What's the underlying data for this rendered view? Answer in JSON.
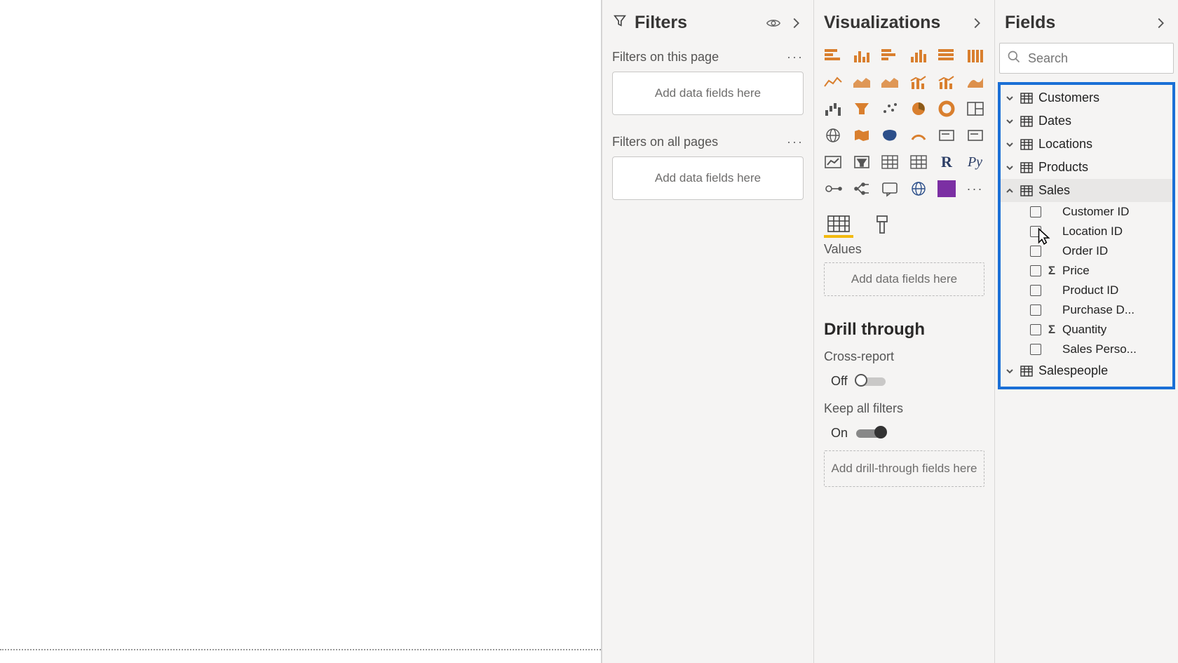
{
  "filters": {
    "title": "Filters",
    "page_label": "Filters on this page",
    "all_label": "Filters on all pages",
    "drop_placeholder": "Add data fields here"
  },
  "viz": {
    "title": "Visualizations",
    "values_label": "Values",
    "values_placeholder": "Add data fields here",
    "drill_heading": "Drill through",
    "cross_report_label": "Cross-report",
    "cross_report_state": "Off",
    "keep_filters_label": "Keep all filters",
    "keep_filters_state": "On",
    "drill_placeholder": "Add drill-through fields here",
    "chips": [
      "stacked-bar",
      "stacked-column",
      "clustered-bar",
      "clustered-column",
      "100-bar",
      "100-column",
      "line",
      "area",
      "stacked-area",
      "line-column",
      "line-column-2",
      "ribbon",
      "waterfall",
      "funnel",
      "scatter",
      "pie",
      "donut",
      "treemap",
      "map",
      "filled-map",
      "shape-map",
      "gauge",
      "card",
      "multi-card",
      "kpi",
      "slicer",
      "table",
      "matrix",
      "r-visual",
      "python-visual",
      "key-influencers",
      "decomposition",
      "q-and-a",
      "arcgis",
      "powerapps",
      "more"
    ]
  },
  "fields": {
    "title": "Fields",
    "search_placeholder": "Search",
    "tables": [
      {
        "name": "Customers",
        "expanded": false
      },
      {
        "name": "Dates",
        "expanded": false
      },
      {
        "name": "Locations",
        "expanded": false
      },
      {
        "name": "Products",
        "expanded": false
      },
      {
        "name": "Sales",
        "expanded": true,
        "hovered": true,
        "fields": [
          {
            "name": "Customer ID",
            "sigma": false
          },
          {
            "name": "Location ID",
            "sigma": false
          },
          {
            "name": "Order ID",
            "sigma": false
          },
          {
            "name": "Price",
            "sigma": true
          },
          {
            "name": "Product ID",
            "sigma": false
          },
          {
            "name": "Purchase D...",
            "sigma": false
          },
          {
            "name": "Quantity",
            "sigma": true
          },
          {
            "name": "Sales Perso...",
            "sigma": false
          }
        ]
      },
      {
        "name": "Salespeople",
        "expanded": false
      }
    ]
  }
}
